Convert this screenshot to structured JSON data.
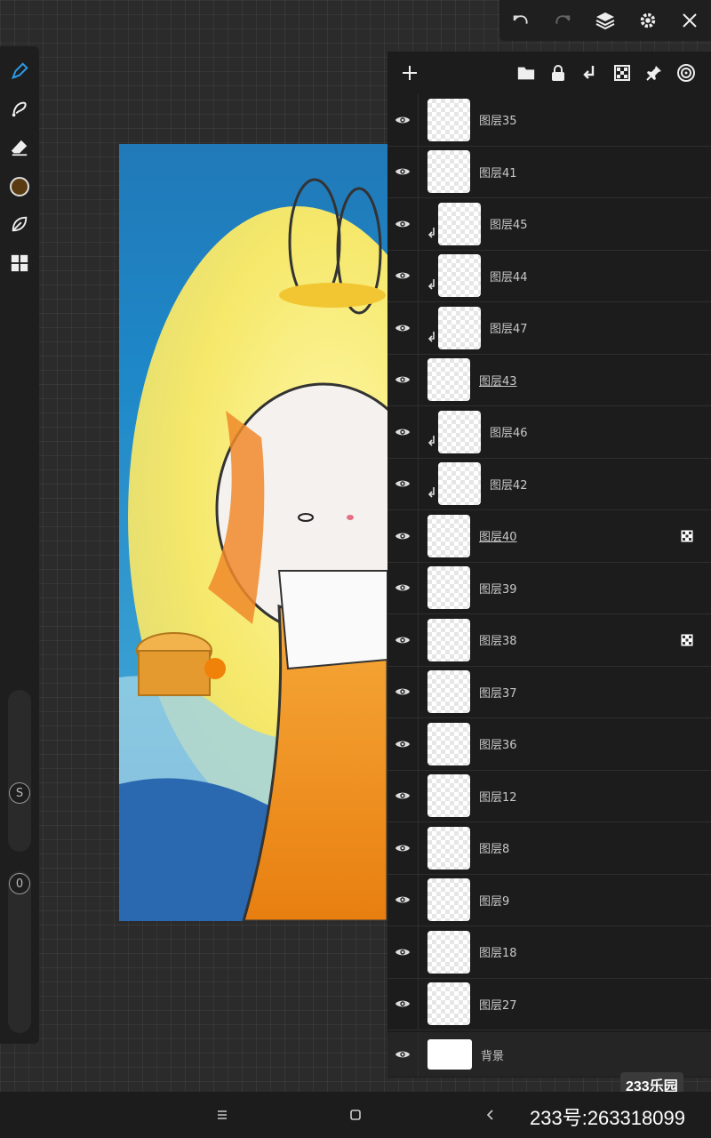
{
  "layers": [
    {
      "name": "图层35",
      "clip": false,
      "alpha": false,
      "underline": false
    },
    {
      "name": "图层41",
      "clip": false,
      "alpha": false,
      "underline": false
    },
    {
      "name": "图层45",
      "clip": true,
      "alpha": false,
      "underline": false
    },
    {
      "name": "图层44",
      "clip": true,
      "alpha": false,
      "underline": false
    },
    {
      "name": "图层47",
      "clip": true,
      "alpha": false,
      "underline": false
    },
    {
      "name": "图层43",
      "clip": false,
      "alpha": false,
      "underline": true
    },
    {
      "name": "图层46",
      "clip": true,
      "alpha": false,
      "underline": false
    },
    {
      "name": "图层42",
      "clip": true,
      "alpha": false,
      "underline": false
    },
    {
      "name": "图层40",
      "clip": false,
      "alpha": true,
      "underline": true
    },
    {
      "name": "图层39",
      "clip": false,
      "alpha": false,
      "underline": false
    },
    {
      "name": "图层38",
      "clip": false,
      "alpha": true,
      "underline": false
    },
    {
      "name": "图层37",
      "clip": false,
      "alpha": false,
      "underline": false
    },
    {
      "name": "图层36",
      "clip": false,
      "alpha": false,
      "underline": false
    },
    {
      "name": "图层12",
      "clip": false,
      "alpha": false,
      "underline": false
    },
    {
      "name": "图层8",
      "clip": false,
      "alpha": false,
      "underline": false
    },
    {
      "name": "图层9",
      "clip": false,
      "alpha": false,
      "underline": false
    },
    {
      "name": "图层18",
      "clip": false,
      "alpha": false,
      "underline": false
    },
    {
      "name": "图层27",
      "clip": false,
      "alpha": false,
      "underline": false
    }
  ],
  "background_layer": {
    "name": "背景"
  },
  "left_toolbar": {
    "size_label": "S",
    "opacity_label": "0",
    "current_color": "#5a3a10"
  },
  "watermark": {
    "logo": "233乐园",
    "id_text": "233号:263318099"
  },
  "colors": {
    "accent": "#2a9be8"
  }
}
